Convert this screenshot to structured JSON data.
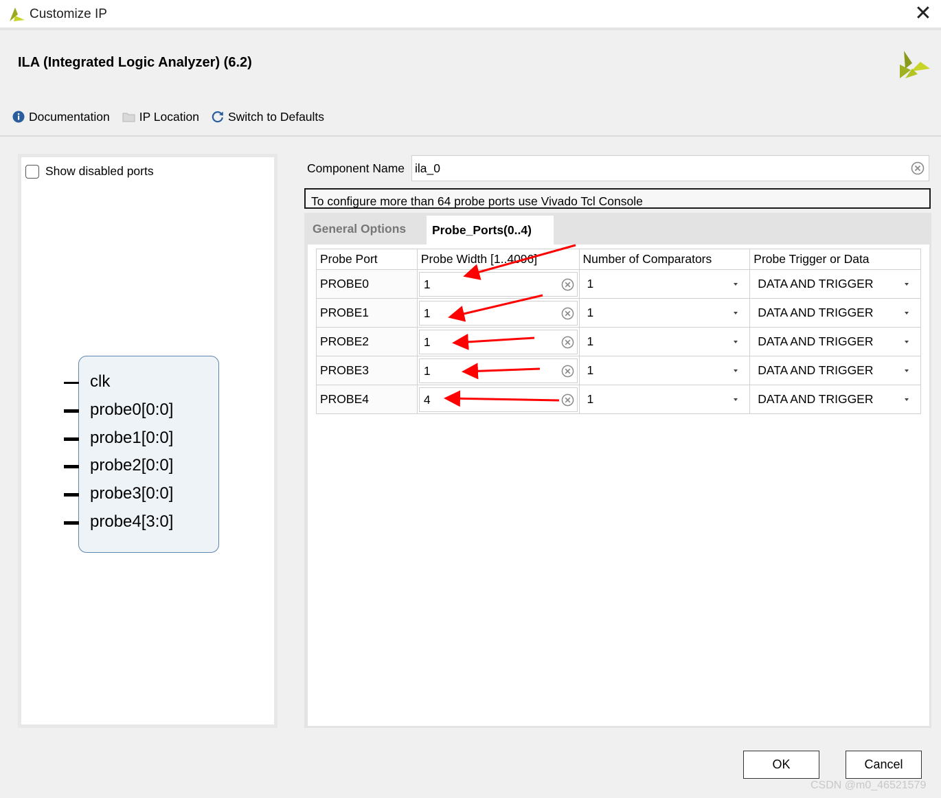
{
  "window": {
    "title": "Customize IP",
    "close_glyph": "✕"
  },
  "ip": {
    "title": "ILA (Integrated Logic Analyzer) (6.2)"
  },
  "toolbar": {
    "documentation": "Documentation",
    "ip_location": "IP Location",
    "switch_defaults": "Switch to Defaults"
  },
  "left": {
    "show_disabled_label": "Show disabled ports",
    "show_disabled_checked": false,
    "ports": [
      "clk",
      "probe0[0:0]",
      "probe1[0:0]",
      "probe2[0:0]",
      "probe3[0:0]",
      "probe4[3:0]"
    ]
  },
  "component": {
    "label": "Component Name",
    "value": "ila_0"
  },
  "info": "To configure more than 64 probe ports use Vivado Tcl Console",
  "tabs": [
    {
      "label": "General Options",
      "active": false
    },
    {
      "label": "Probe_Ports(0..4)",
      "active": true
    }
  ],
  "table": {
    "headers": [
      "Probe Port",
      "Probe Width [1..4096]",
      "Number of Comparators",
      "Probe Trigger or Data"
    ],
    "rows": [
      {
        "port": "PROBE0",
        "width": "1",
        "comparators": "1",
        "trigger": "DATA AND TRIGGER"
      },
      {
        "port": "PROBE1",
        "width": "1",
        "comparators": "1",
        "trigger": "DATA AND TRIGGER"
      },
      {
        "port": "PROBE2",
        "width": "1",
        "comparators": "1",
        "trigger": "DATA AND TRIGGER"
      },
      {
        "port": "PROBE3",
        "width": "1",
        "comparators": "1",
        "trigger": "DATA AND TRIGGER"
      },
      {
        "port": "PROBE4",
        "width": "4",
        "comparators": "1",
        "trigger": "DATA AND TRIGGER"
      }
    ]
  },
  "buttons": {
    "ok": "OK",
    "cancel": "Cancel"
  },
  "watermark": "CSDN @m0_46521579",
  "colors": {
    "annotation_arrow": "#ff0000",
    "logo_dark": "#8a9a1b",
    "logo_light": "#c7d52a"
  }
}
